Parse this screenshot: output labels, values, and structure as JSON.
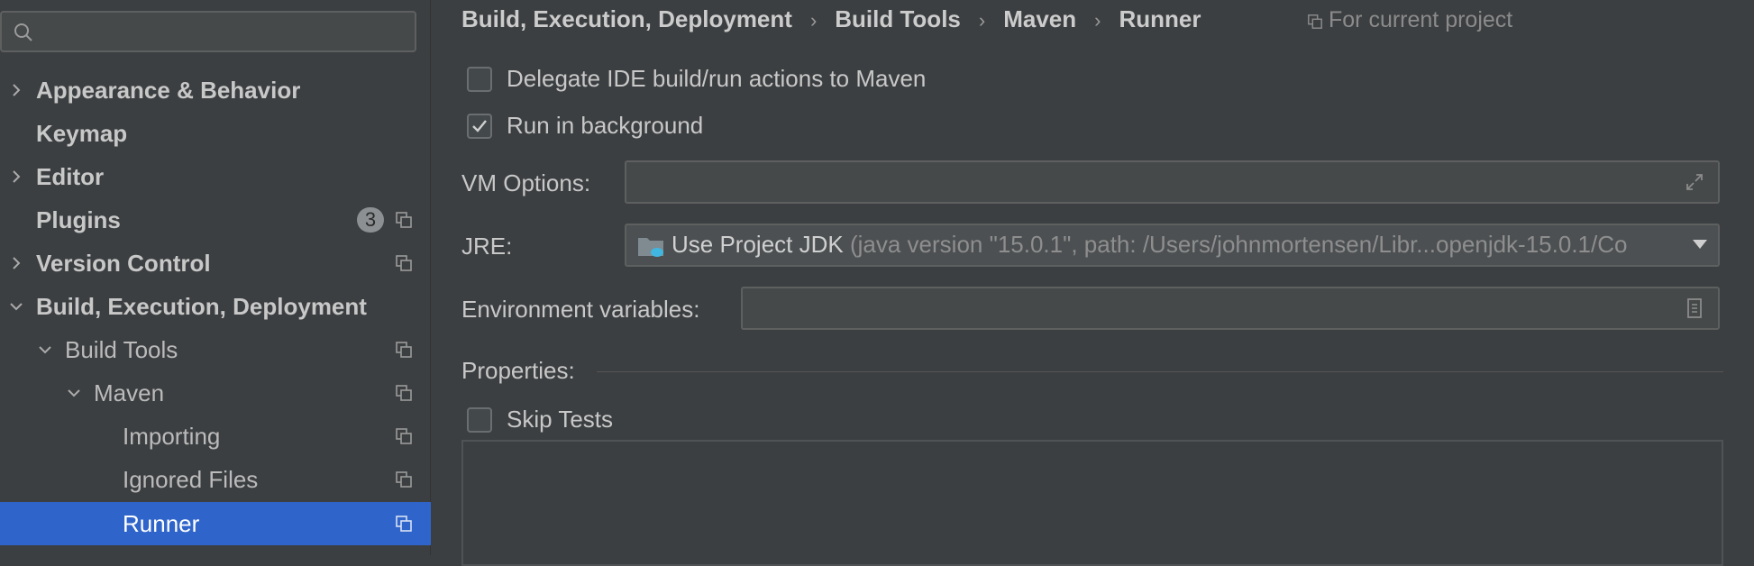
{
  "sidebar": {
    "search": {
      "value": "",
      "placeholder": ""
    },
    "items": [
      {
        "label": "Appearance & Behavior",
        "bold": true,
        "expandable": true,
        "expanded": false
      },
      {
        "label": "Keymap",
        "bold": true,
        "expandable": false
      },
      {
        "label": "Editor",
        "bold": true,
        "expandable": true,
        "expanded": false
      },
      {
        "label": "Plugins",
        "bold": true,
        "expandable": false,
        "badge": "3"
      },
      {
        "label": "Version Control",
        "bold": true,
        "expandable": true,
        "expanded": false
      },
      {
        "label": "Build, Execution, Deployment",
        "bold": true,
        "expandable": true,
        "expanded": true
      },
      {
        "label": "Build Tools",
        "bold": false,
        "expandable": true,
        "expanded": true
      },
      {
        "label": "Maven",
        "bold": false,
        "expandable": true,
        "expanded": true
      },
      {
        "label": "Importing",
        "bold": false,
        "expandable": false
      },
      {
        "label": "Ignored Files",
        "bold": false,
        "expandable": false
      },
      {
        "label": "Runner",
        "bold": false,
        "expandable": false,
        "selected": true
      }
    ]
  },
  "breadcrumb": [
    "Build, Execution, Deployment",
    "Build Tools",
    "Maven",
    "Runner"
  ],
  "breadcrumb_separator": "›",
  "scope_label": "For current project",
  "checkboxes": {
    "delegate": {
      "label": "Delegate IDE build/run actions to Maven",
      "checked": false
    },
    "background": {
      "label": "Run in background",
      "checked": true
    },
    "skip_tests": {
      "label": "Skip Tests",
      "checked": false
    }
  },
  "vm_options": {
    "label": "VM Options:",
    "value": ""
  },
  "jre": {
    "label": "JRE:",
    "selected": "Use Project JDK",
    "detail": "(java version \"15.0.1\", path: /Users/johnmortensen/Libr...openjdk-15.0.1/Co"
  },
  "env_vars": {
    "label": "Environment variables:",
    "value": ""
  },
  "properties": {
    "label": "Properties:"
  },
  "colors": {
    "selection": "#2f65ca",
    "background": "#3c3f41",
    "badge": "#8c9092"
  }
}
